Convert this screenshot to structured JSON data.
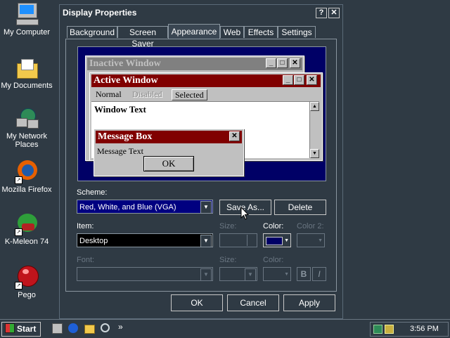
{
  "desktop": {
    "icons": [
      {
        "label": "My Computer"
      },
      {
        "label": "My Documents"
      },
      {
        "label": "My Network Places"
      },
      {
        "label": "Mozilla Firefox"
      },
      {
        "label": "K-Meleon 74"
      },
      {
        "label": "Pego"
      }
    ]
  },
  "dialog": {
    "title": "Display Properties",
    "help_glyph": "?",
    "close_glyph": "✕",
    "tabs": [
      {
        "label": "Background"
      },
      {
        "label": "Screen Saver"
      },
      {
        "label": "Appearance"
      },
      {
        "label": "Web"
      },
      {
        "label": "Effects"
      },
      {
        "label": "Settings"
      }
    ],
    "preview": {
      "inactive_title": "Inactive Window",
      "active_title": "Active Window",
      "menu_normal": "Normal",
      "menu_disabled": "Disabled",
      "menu_selected": "Selected",
      "window_text": "Window Text",
      "msgbox_title": "Message Box",
      "msgbox_text": "Message Text",
      "msgbox_ok": "OK",
      "min_glyph": "_",
      "max_glyph": "□",
      "close_glyph": "✕"
    },
    "scheme": {
      "label": "Scheme:",
      "value": "Red, White, and Blue (VGA)",
      "save_as": "Save As...",
      "delete": "Delete"
    },
    "item": {
      "label": "Item:",
      "value": "Desktop",
      "size_label": "Size:",
      "color_label": "Color:",
      "color2_label": "Color 2:",
      "color_value": "#000066"
    },
    "font": {
      "label": "Font:",
      "size_label": "Size:",
      "color_label": "Color:",
      "bold": "B",
      "italic": "I"
    },
    "buttons": {
      "ok": "OK",
      "cancel": "Cancel",
      "apply": "Apply"
    }
  },
  "taskbar": {
    "start": "Start",
    "more_glyph": "»",
    "clock": "3:56 PM"
  },
  "colors": {
    "active_title": "#800000",
    "inactive_title": "#808080",
    "desktop": "#2f3a44"
  }
}
